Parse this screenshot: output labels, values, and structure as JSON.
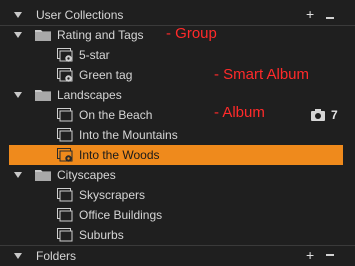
{
  "sections": {
    "user_collections": "User Collections",
    "folders": "Folders"
  },
  "groups": [
    {
      "label": "Rating and Tags"
    },
    {
      "label": "Landscapes"
    },
    {
      "label": "Cityscapes"
    }
  ],
  "items": {
    "five_star": "5-star",
    "green_tag": "Green tag",
    "on_the_beach": "On the Beach",
    "into_the_mountains": "Into the Mountains",
    "into_the_woods": "Into the Woods",
    "skyscrapers": "Skyscrapers",
    "office_buildings": "Office Buildings",
    "suburbs": "Suburbs"
  },
  "badges": {
    "on_the_beach_count": "7"
  },
  "annotations": {
    "group": "- Group",
    "smart_album": "- Smart Album",
    "album": "- Album"
  },
  "header_buttons": {
    "add": "+"
  },
  "colors": {
    "background": "#1f1f1f",
    "selection": "#ef8a1c",
    "annotation": "#ff2a2a",
    "text": "#d6d6d6"
  },
  "icons": [
    "disclosure-triangle-icon",
    "folder-icon",
    "smart-album-icon",
    "album-icon",
    "camera-icon",
    "plus-icon",
    "minus-icon"
  ]
}
